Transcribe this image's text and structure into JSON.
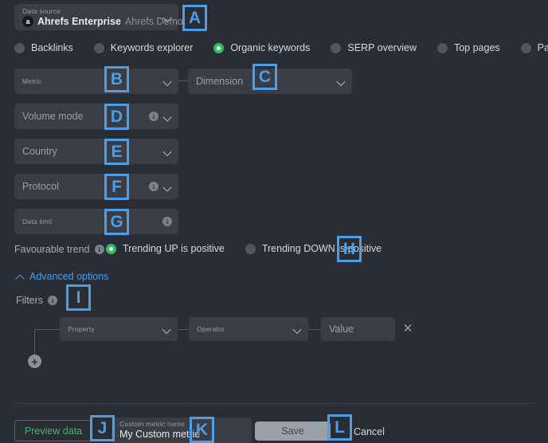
{
  "data_source": {
    "label": "Data source",
    "value": "Ahrefs Enterprise",
    "secondary": "Ahrefs Demo",
    "avatar_letter": "a",
    "chevron_icon": "chevron-down-icon"
  },
  "report_types": [
    {
      "label": "Backlinks",
      "selected": false
    },
    {
      "label": "Keywords explorer",
      "selected": false
    },
    {
      "label": "Organic keywords",
      "selected": true
    },
    {
      "label": "SERP overview",
      "selected": false
    },
    {
      "label": "Top pages",
      "selected": false
    },
    {
      "label": "Paid pages",
      "selected": false
    }
  ],
  "fields": {
    "metric": {
      "placeholder": "Metric",
      "type": "small-label"
    },
    "dimension": {
      "placeholder": "Dimension",
      "type": "placeholder"
    },
    "volume_mode": {
      "placeholder": "Volume mode",
      "has_info": true
    },
    "country": {
      "placeholder": "Country",
      "has_info": false
    },
    "protocol": {
      "placeholder": "Protocol",
      "has_info": true
    },
    "data_limit": {
      "placeholder": "Data limit",
      "has_info": true
    }
  },
  "favourable_trend": {
    "label": "Favourable trend",
    "info_icon": "info-icon",
    "options": [
      {
        "label": "Trending UP is positive",
        "selected": true
      },
      {
        "label": "Trending DOWN is positive",
        "selected": false
      }
    ]
  },
  "advanced_options": {
    "label": "Advanced options",
    "chevron_icon": "chevron-up-icon",
    "expanded": true
  },
  "filters": {
    "label": "Filters",
    "info_icon": "info-icon",
    "rows": [
      {
        "property": {
          "placeholder": "Property"
        },
        "operator": {
          "placeholder": "Operator"
        },
        "value": {
          "placeholder": "Value"
        },
        "remove_icon": "close-icon"
      }
    ],
    "add_icon": "plus-icon"
  },
  "footer": {
    "preview_label": "Preview data",
    "custom_metric_label": "Custom metric name",
    "custom_metric_value": "My Custom metric",
    "save_label": "Save",
    "cancel_label": "Cancel"
  },
  "annotations": [
    {
      "id": "A"
    },
    {
      "id": "B"
    },
    {
      "id": "C"
    },
    {
      "id": "D"
    },
    {
      "id": "E"
    },
    {
      "id": "F"
    },
    {
      "id": "G"
    },
    {
      "id": "H"
    },
    {
      "id": "I"
    },
    {
      "id": "J"
    },
    {
      "id": "K"
    },
    {
      "id": "L"
    }
  ],
  "colors": {
    "background": "#2a2d33",
    "field": "#3a3d43",
    "accent_blue": "#4a9eea",
    "accent_green": "#2fbf61",
    "outline_green": "#4fae74"
  }
}
